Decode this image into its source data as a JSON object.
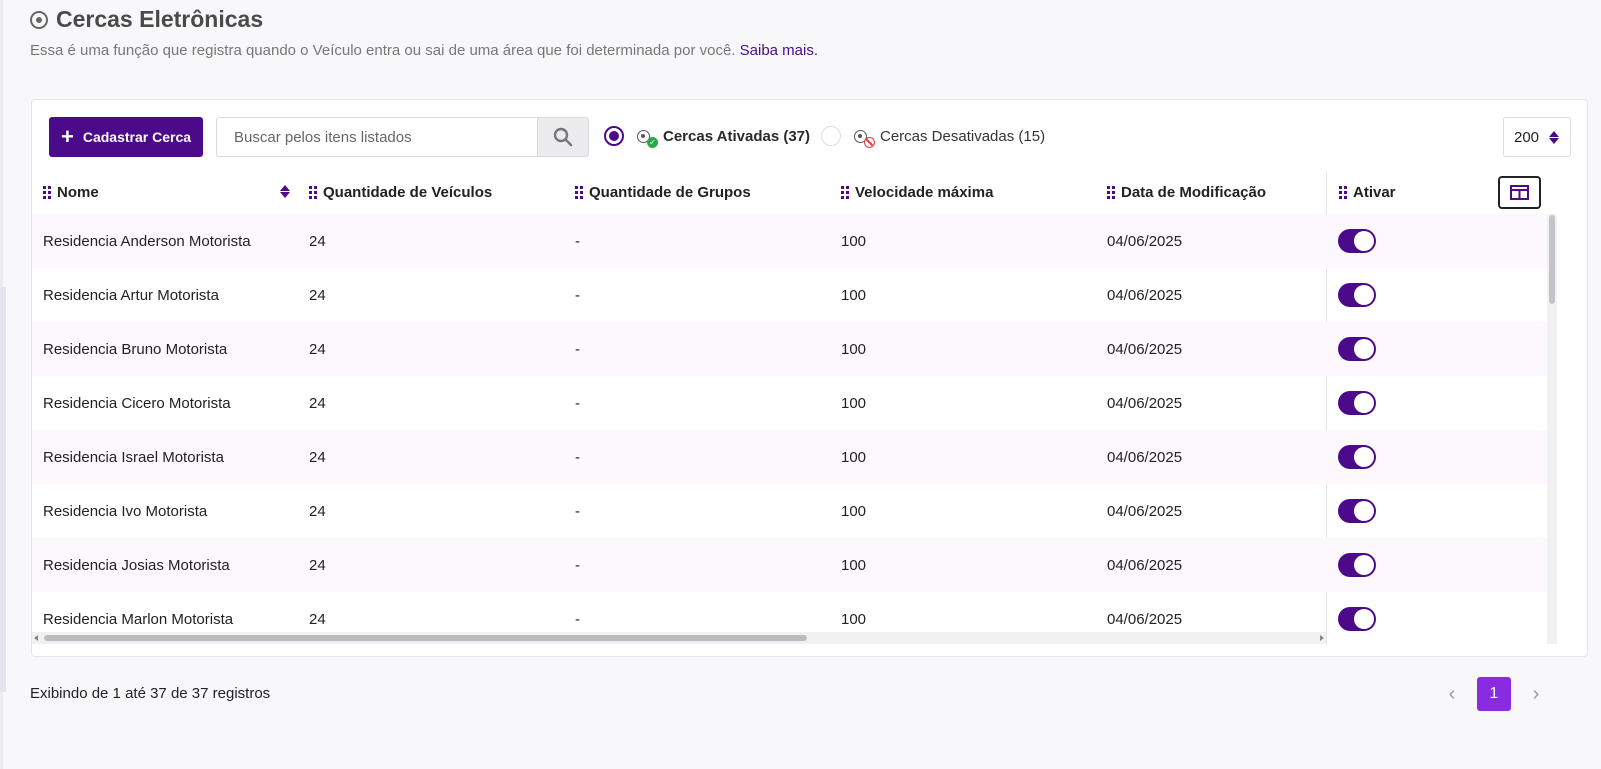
{
  "header": {
    "title": "Cercas Eletrônicas",
    "subtitle": "Essa é uma função que registra quando o Veículo entra ou sai de uma área que foi determinada por você.",
    "learn_more": "Saiba mais."
  },
  "toolbar": {
    "add_label": "Cadastrar Cerca",
    "search_placeholder": "Buscar pelos itens listados",
    "filter_active": "Cercas Ativadas (37)",
    "filter_inactive": "Cercas Desativadas (15)",
    "page_size": "200"
  },
  "table": {
    "columns": [
      "Nome",
      "Quantidade de Veículos",
      "Quantidade de Grupos",
      "Velocidade máxima",
      "Data de Modificação",
      "Ativar"
    ],
    "rows": [
      {
        "nome": "Residencia Anderson Motorista",
        "veiculos": "24",
        "grupos": "-",
        "velocidade": "100",
        "data": "04/06/2025",
        "ativo": true
      },
      {
        "nome": "Residencia Artur Motorista",
        "veiculos": "24",
        "grupos": "-",
        "velocidade": "100",
        "data": "04/06/2025",
        "ativo": true
      },
      {
        "nome": "Residencia Bruno Motorista",
        "veiculos": "24",
        "grupos": "-",
        "velocidade": "100",
        "data": "04/06/2025",
        "ativo": true
      },
      {
        "nome": "Residencia Cicero Motorista",
        "veiculos": "24",
        "grupos": "-",
        "velocidade": "100",
        "data": "04/06/2025",
        "ativo": true
      },
      {
        "nome": "Residencia Israel Motorista",
        "veiculos": "24",
        "grupos": "-",
        "velocidade": "100",
        "data": "04/06/2025",
        "ativo": true
      },
      {
        "nome": "Residencia Ivo Motorista",
        "veiculos": "24",
        "grupos": "-",
        "velocidade": "100",
        "data": "04/06/2025",
        "ativo": true
      },
      {
        "nome": "Residencia Josias Motorista",
        "veiculos": "24",
        "grupos": "-",
        "velocidade": "100",
        "data": "04/06/2025",
        "ativo": true
      },
      {
        "nome": "Residencia Marlon Motorista",
        "veiculos": "24",
        "grupos": "-",
        "velocidade": "100",
        "data": "04/06/2025",
        "ativo": true
      }
    ]
  },
  "footer": {
    "info": "Exibindo de 1 até 37 de 37 registros",
    "current_page": "1"
  },
  "colors": {
    "brand": "#4b0a8a",
    "page_active": "#8a2be2",
    "success": "#2aa84a",
    "danger": "#e04040"
  },
  "icons": [
    "target-icon",
    "plus-icon",
    "search-icon",
    "fence-active-icon",
    "fence-inactive-icon",
    "sort-icon",
    "drag-handle-icon",
    "columns-icon",
    "chevron-left-icon",
    "chevron-right-icon"
  ]
}
